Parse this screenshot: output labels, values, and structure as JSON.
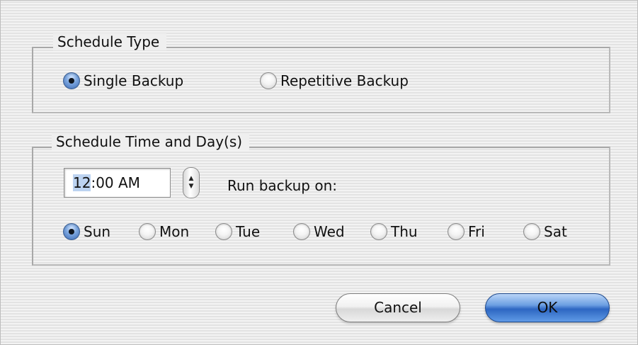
{
  "dialog": {
    "schedule_type": {
      "title": "Schedule Type",
      "options": [
        {
          "label": "Single Backup",
          "checked": true
        },
        {
          "label": "Repetitive Backup",
          "checked": false
        }
      ]
    },
    "schedule_time": {
      "title": "Schedule Time and Day(s)",
      "time_hour": "12",
      "time_rest": ":00 AM",
      "stepper_up": "▲",
      "stepper_down": "▼",
      "run_label": "Run backup on:",
      "days": [
        {
          "label": "Sun",
          "checked": true
        },
        {
          "label": "Mon",
          "checked": false
        },
        {
          "label": "Tue",
          "checked": false
        },
        {
          "label": "Wed",
          "checked": false
        },
        {
          "label": "Thu",
          "checked": false
        },
        {
          "label": "Fri",
          "checked": false
        },
        {
          "label": "Sat",
          "checked": false
        }
      ]
    },
    "buttons": {
      "cancel": "Cancel",
      "ok": "OK"
    },
    "colors": {
      "default_button": "#2d66c2",
      "selection": "#bcd3f1"
    }
  }
}
